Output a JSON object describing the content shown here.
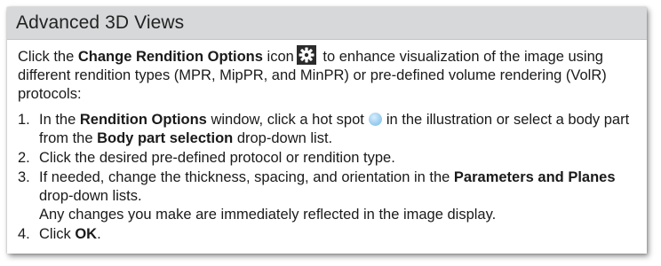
{
  "doc": {
    "title": "Advanced 3D Views",
    "intro": {
      "t1": "Click the ",
      "b1": "Change Rendition Options",
      "t2": " icon",
      "t3": " to enhance visualization of the image using different rendition types (MPR, MipPR, and MinPR) or pre-defined volume rendering (VolR) protocols:"
    },
    "steps": [
      {
        "num": "1.",
        "t1": "In the ",
        "b1": "Rendition Options",
        "t2": " window, click a hot spot",
        "t3": "in the illustration or select a body part from the ",
        "b2": "Body part selection",
        "t4": " drop-down list."
      },
      {
        "num": "2.",
        "text": "Click the desired pre-defined protocol or rendition type."
      },
      {
        "num": "3.",
        "t1": "If needed, change the thickness, spacing, and orientation in the ",
        "b1": "Parameters and Planes",
        "t2": " drop-down lists.",
        "note": "Any changes you make are immediately reflected in the image display."
      },
      {
        "num": "4.",
        "t1": "Click ",
        "b1": "OK",
        "t2": "."
      }
    ]
  },
  "icons": {
    "gear": "gear-icon",
    "hotspot": "hot-spot-icon"
  },
  "colors": {
    "title_bar": "#d6d8da",
    "hotspot": "#9ecff0"
  }
}
